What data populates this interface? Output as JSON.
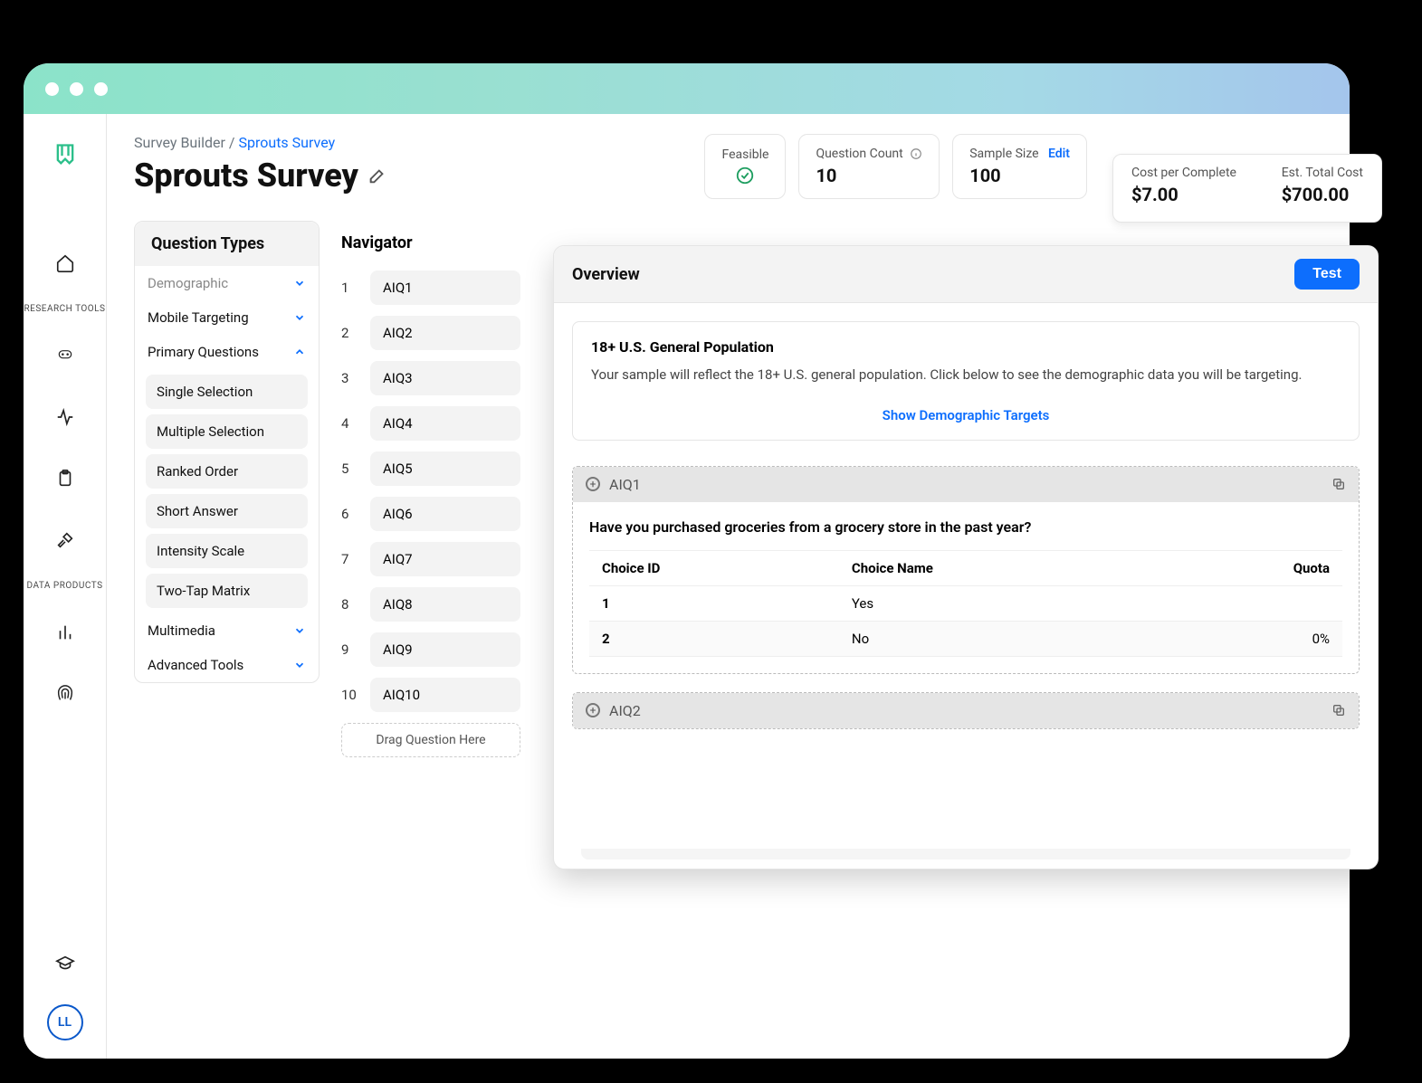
{
  "breadcrumb": {
    "root": "Survey Builder",
    "sep": "/",
    "current": "Sprouts Survey"
  },
  "page_title": "Sprouts Survey",
  "avatar": "LL",
  "sidebar": {
    "label_research": "RESEARCH TOOLS",
    "label_data": "DATA PRODUCTS"
  },
  "stats": {
    "feasible_label": "Feasible",
    "qcount_label": "Question Count",
    "qcount_value": "10",
    "sample_label": "Sample Size",
    "sample_edit": "Edit",
    "sample_value": "100",
    "cost_label": "Cost per Complete",
    "cost_value": "$7.00",
    "total_label": "Est. Total Cost",
    "total_value": "$700.00"
  },
  "qtypes": {
    "heading": "Question Types",
    "groups": [
      {
        "label": "Demographic",
        "open": false,
        "muted": true
      },
      {
        "label": "Mobile Targeting",
        "open": false
      },
      {
        "label": "Primary Questions",
        "open": true,
        "items": [
          "Single Selection",
          "Multiple Selection",
          "Ranked Order",
          "Short Answer",
          "Intensity Scale",
          "Two-Tap Matrix"
        ]
      },
      {
        "label": "Multimedia",
        "open": false
      },
      {
        "label": "Advanced Tools",
        "open": false
      }
    ]
  },
  "navigator": {
    "heading": "Navigator",
    "items": [
      "AIQ1",
      "AIQ2",
      "AIQ3",
      "AIQ4",
      "AIQ5",
      "AIQ6",
      "AIQ7",
      "AIQ8",
      "AIQ9",
      "AIQ10"
    ],
    "drop_text": "Drag Question Here"
  },
  "overview": {
    "heading": "Overview",
    "test_btn": "Test",
    "info_title": "18+ U.S. General Population",
    "info_text": "Your sample will reflect the 18+ U.S. general population. Click below to see the demographic data you will be targeting.",
    "info_link": "Show Demographic Targets",
    "q1": {
      "id": "AIQ1",
      "text": "Have you purchased groceries from a grocery store in the past year?",
      "cols": {
        "id": "Choice ID",
        "name": "Choice Name",
        "quota": "Quota"
      },
      "rows": [
        {
          "id": "1",
          "name": "Yes",
          "quota": ""
        },
        {
          "id": "2",
          "name": "No",
          "quota": "0%"
        }
      ]
    },
    "q2": {
      "id": "AIQ2"
    }
  }
}
